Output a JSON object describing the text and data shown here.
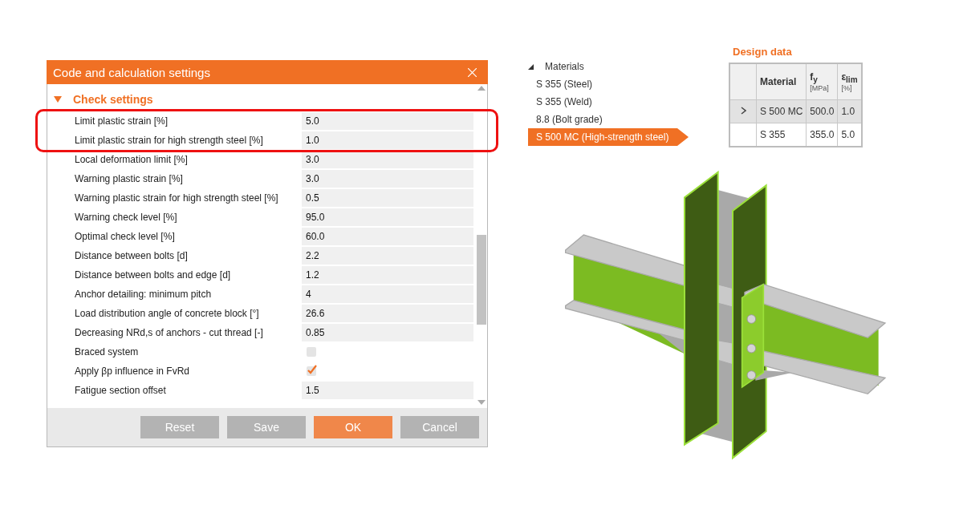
{
  "dialog": {
    "title": "Code and calculation settings",
    "section": {
      "title": "Check settings",
      "expanded": true
    },
    "rows": [
      {
        "kind": "value",
        "label": "Limit plastic strain [%]",
        "value": "5.0",
        "highlighted": true
      },
      {
        "kind": "value",
        "label": "Limit plastic strain for high strength steel [%]",
        "value": "1.0",
        "highlighted": true
      },
      {
        "kind": "value",
        "label": "Local deformation limit [%]",
        "value": "3.0",
        "highlighted": false
      },
      {
        "kind": "value",
        "label": "Warning plastic strain [%]",
        "value": "3.0",
        "highlighted": false
      },
      {
        "kind": "value",
        "label": "Warning plastic strain for high strength steel [%]",
        "value": "0.5",
        "highlighted": false
      },
      {
        "kind": "value",
        "label": "Warning check level [%]",
        "value": "95.0",
        "highlighted": false
      },
      {
        "kind": "value",
        "label": "Optimal check level [%]",
        "value": "60.0",
        "highlighted": false
      },
      {
        "kind": "value",
        "label": "Distance between bolts [d]",
        "value": "2.2",
        "highlighted": false
      },
      {
        "kind": "value",
        "label": "Distance between bolts and edge [d]",
        "value": "1.2",
        "highlighted": false
      },
      {
        "kind": "value",
        "label": "Anchor detailing: minimum pitch",
        "value": "4",
        "highlighted": false
      },
      {
        "kind": "value",
        "label": "Load distribution angle of concrete block [°]",
        "value": "26.6",
        "highlighted": false
      },
      {
        "kind": "value",
        "label": "Decreasing NRd,s of anchors - cut thread [-]",
        "value": "0.85",
        "highlighted": false
      },
      {
        "kind": "checkbox",
        "label": "Braced system",
        "checked": false,
        "highlighted": false
      },
      {
        "kind": "checkbox",
        "label": "Apply βp influence in FvRd",
        "checked": true,
        "highlighted": false
      },
      {
        "kind": "value",
        "label": "Fatigue section offset",
        "value": "1.5",
        "highlighted": false
      }
    ],
    "buttons": [
      {
        "label": "Reset",
        "primary": false
      },
      {
        "label": "Save",
        "primary": false
      },
      {
        "label": "OK",
        "primary": true
      },
      {
        "label": "Cancel",
        "primary": false
      }
    ]
  },
  "materials": {
    "label": "Materials",
    "expanded": true,
    "children": [
      {
        "label": "S 355 (Steel)",
        "selected": false
      },
      {
        "label": "S 355 (Weld)",
        "selected": false
      },
      {
        "label": "8.8 (Bolt grade)",
        "selected": false
      },
      {
        "label": "S 500 MC (High-strength steel)",
        "selected": true
      }
    ]
  },
  "design_data": {
    "title": "Design data",
    "columns": [
      {
        "label": "Material"
      },
      {
        "label": "f$_{y}$",
        "unit": "[MPa]"
      },
      {
        "label": "ε$_{lim}$",
        "unit": "[%]"
      }
    ],
    "rows": [
      {
        "selected": true,
        "cells": [
          "S 500 MC",
          "500.0",
          "1.0"
        ]
      },
      {
        "selected": false,
        "cells": [
          "S 355",
          "355.0",
          "5.0"
        ]
      }
    ]
  }
}
